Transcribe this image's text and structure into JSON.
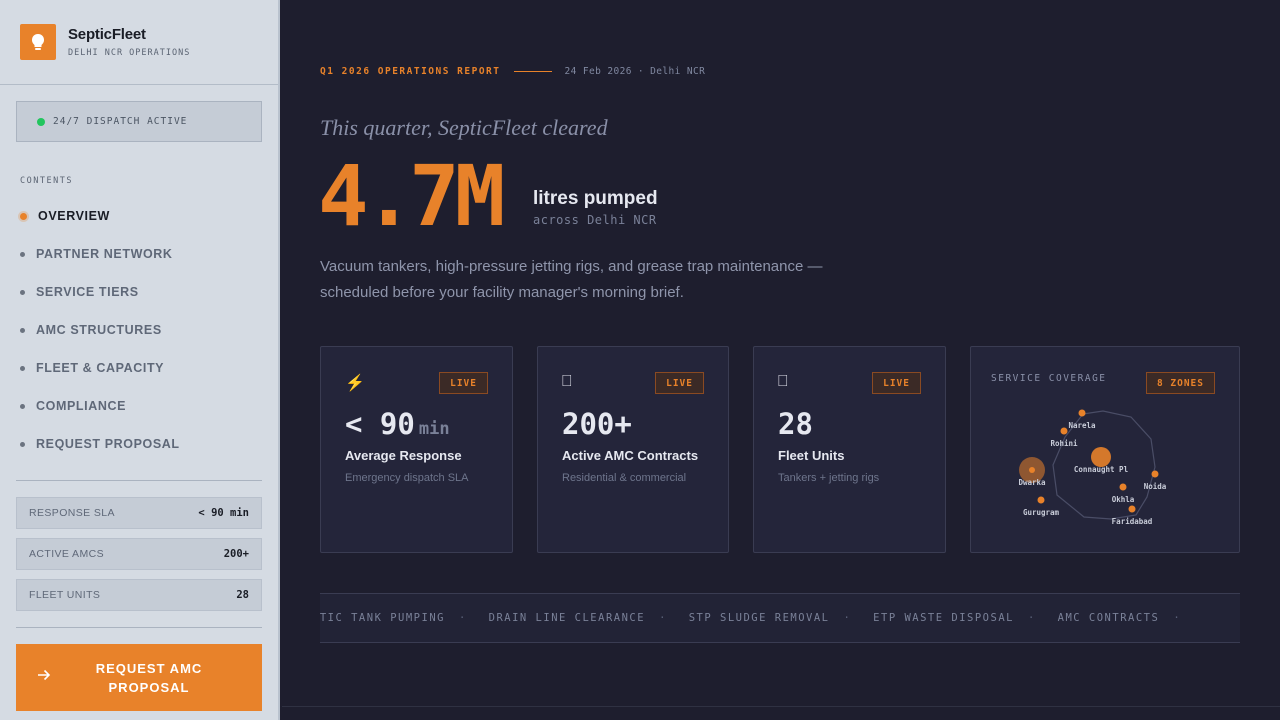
{
  "brand": {
    "name": "SepticFleet",
    "subtitle": "DELHI NCR OPERATIONS",
    "logo_icon": "bulb-icon"
  },
  "dispatch": {
    "status": "24/7 DISPATCH ACTIVE",
    "color": "#22c55e"
  },
  "contents_label": "CONTENTS",
  "nav": [
    {
      "label": "OVERVIEW",
      "active": true
    },
    {
      "label": "PARTNER NETWORK"
    },
    {
      "label": "SERVICE TIERS"
    },
    {
      "label": "AMC STRUCTURES"
    },
    {
      "label": "FLEET & CAPACITY"
    },
    {
      "label": "COMPLIANCE"
    },
    {
      "label": "REQUEST PROPOSAL"
    }
  ],
  "stats": [
    {
      "label": "RESPONSE SLA",
      "value": "< 90 min"
    },
    {
      "label": "ACTIVE AMCS",
      "value": "200+"
    },
    {
      "label": "FLEET UNITS",
      "value": "28"
    }
  ],
  "cta": {
    "label": "REQUEST AMC PROPOSAL",
    "icon": "arrow-right-icon"
  },
  "report": {
    "title": "Q1 2026 OPERATIONS REPORT",
    "meta": "24 Feb 2026 · Delhi NCR"
  },
  "hero": {
    "intro": "This quarter, SepticFleet cleared",
    "number": "4.7M",
    "unit": "litres pumped",
    "sub": "across Delhi NCR",
    "description": "Vacuum tankers, high-pressure jetting rigs, and grease trap maintenance — scheduled before your facility manager's morning brief."
  },
  "cards": [
    {
      "icon": "lightning-icon",
      "glyph": "⚡",
      "badge": "LIVE",
      "value": "< 90",
      "unit": "min",
      "title": "Average Response",
      "sub": "Emergency dispatch SLA"
    },
    {
      "icon": "document-icon",
      "glyph": "⎕",
      "badge": "LIVE",
      "value": "200+",
      "unit": "",
      "title": "Active AMC Contracts",
      "sub": "Residential & commercial"
    },
    {
      "icon": "truck-icon",
      "glyph": "⎕",
      "badge": "LIVE",
      "value": "28",
      "unit": "",
      "title": "Fleet Units",
      "sub": "Tankers + jetting rigs"
    }
  ],
  "coverage": {
    "title": "SERVICE COVERAGE",
    "badge": "8 ZONES",
    "zones": [
      "Narela",
      "Rohini",
      "Connaught Pl",
      "Dwarka",
      "Noida",
      "Okhla",
      "Gurugram",
      "Faridabad"
    ]
  },
  "ticker": [
    "PTIC TANK PUMPING",
    "DRAIN LINE CLEARANCE",
    "STP SLUDGE REMOVAL",
    "ETP WASTE DISPOSAL",
    "AMC CONTRACTS"
  ],
  "ticker_separator": "·",
  "colors": {
    "accent": "#e8822a",
    "bg": "#1e1e2e",
    "sidebar": "#d5dbe3"
  }
}
